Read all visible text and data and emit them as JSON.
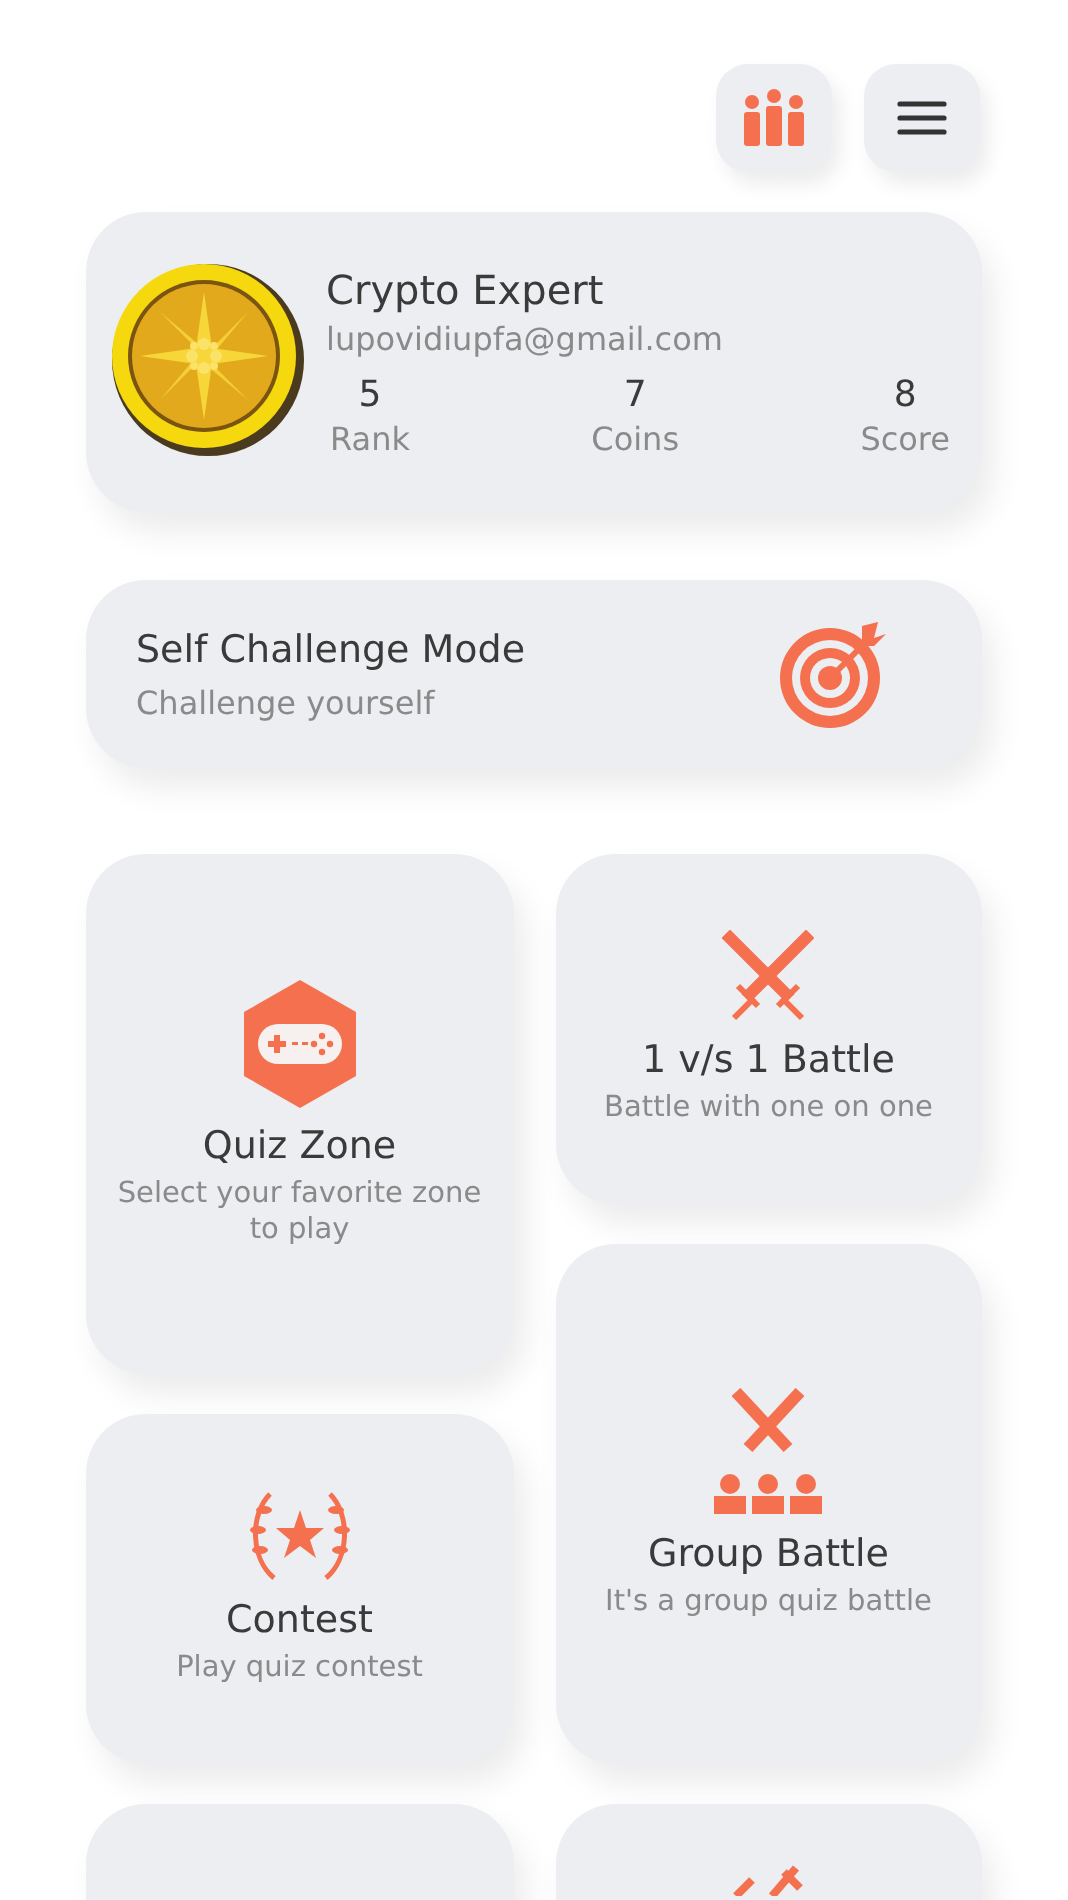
{
  "top_bar": {
    "buttons": [
      {
        "kind": "leaderboard"
      },
      {
        "kind": "menu"
      }
    ]
  },
  "profile": {
    "name": "Crypto Expert",
    "email": "lupovidiupfa@gmail.com",
    "stats": [
      {
        "value": "5",
        "label": "Rank"
      },
      {
        "value": "7",
        "label": "Coins"
      },
      {
        "value": "8",
        "label": "Score"
      }
    ]
  },
  "challenge": {
    "title": "Self Challenge Mode",
    "subtitle": "Challenge yourself"
  },
  "columns": [
    [
      {
        "kind": "gamepad",
        "title": "Quiz Zone",
        "subtitle": "Select your favorite zone to play"
      },
      {
        "kind": "laurel",
        "title": "Contest",
        "subtitle": "Play quiz contest"
      },
      {
        "kind": "blank"
      }
    ],
    [
      {
        "kind": "swords",
        "title": "1 v/s 1 Battle",
        "subtitle": "Battle with one on one"
      },
      {
        "kind": "group",
        "title": "Group Battle",
        "subtitle": "It's a group quiz battle"
      },
      {
        "kind": "partial"
      }
    ]
  ]
}
